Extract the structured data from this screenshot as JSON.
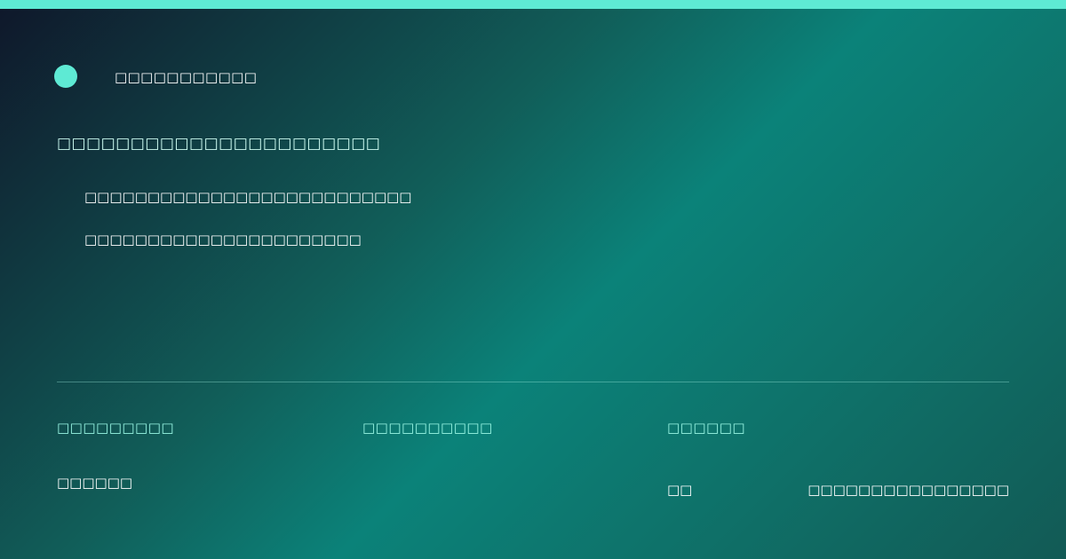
{
  "brand": {
    "logo": "circle-logo",
    "name": "□□□□□□□□□□□"
  },
  "hero": {
    "headline": "□□□□□□□□□□□□□□□□□□□□□□",
    "line_1": "□□□□□□□□□□□□□□□□□□□□□□□□□□",
    "line_2": "□□□□□□□□□□□□□□□□□□□□□□"
  },
  "footer": {
    "col_1_label": "□□□□□□□□□",
    "col_1_value": "□□□□□□",
    "col_2_label": "□□□□□□□□□□",
    "col_3_label": "□□□□□□",
    "col_3_value": "□□",
    "col_4_value": "□□□□□□□□□□□□□□□□"
  },
  "colors": {
    "accent": "#5eead4",
    "background_start": "#0f172a",
    "background_mid": "#0b8279",
    "background_end": "#125a55"
  }
}
